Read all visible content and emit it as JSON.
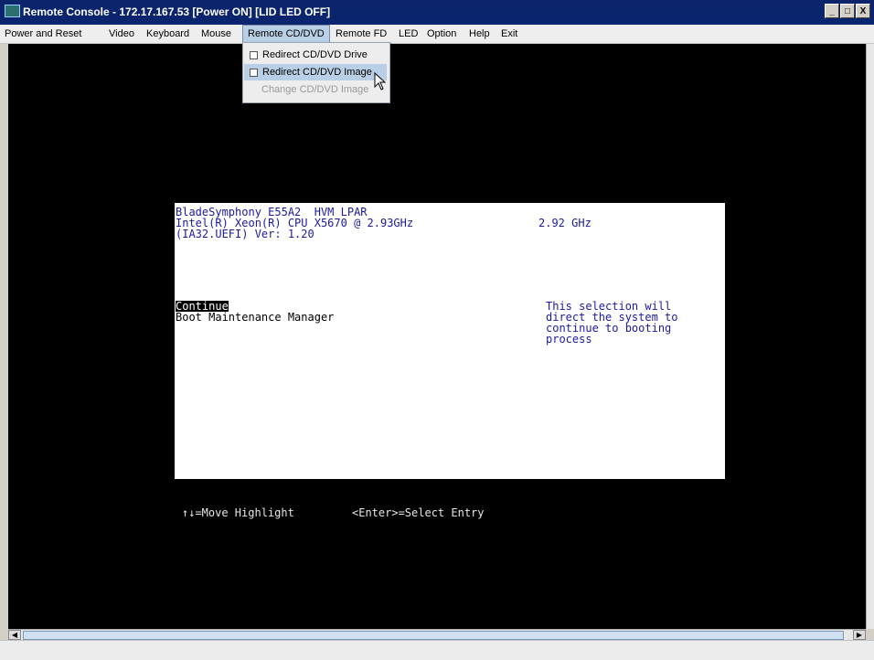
{
  "window": {
    "title": "Remote Console - 172.17.167.53 [Power ON] [LID LED OFF]",
    "minimize_glyph": "_",
    "maximize_glyph": "□",
    "close_glyph": "X"
  },
  "menubar": {
    "items": [
      {
        "label": "Power and Reset"
      },
      {
        "label": "Video"
      },
      {
        "label": "Keyboard"
      },
      {
        "label": "Mouse"
      },
      {
        "label": "Remote CD/DVD",
        "active": true
      },
      {
        "label": "Remote FD"
      },
      {
        "label": "LED"
      },
      {
        "label": "Option"
      },
      {
        "label": "Help"
      },
      {
        "label": "Exit"
      }
    ]
  },
  "dropdown": {
    "items": [
      {
        "label": "Redirect CD/DVD Drive",
        "checkbox": true,
        "checked": false
      },
      {
        "label": "Redirect CD/DVD Image",
        "checkbox": true,
        "checked": false,
        "highlighted": true
      },
      {
        "label": "Change CD/DVD Image",
        "disabled": true
      }
    ]
  },
  "bios": {
    "model": "BladeSymphony E55A2  HVM LPAR",
    "cpu": "Intel(R) Xeon(R) CPU X5670 @ 2.93GHz",
    "freq": "2.92 GHz",
    "firmware": "(IA32.UEFI) Ver: 1.20",
    "menu_items": [
      "Continue",
      "Boot Maintenance Manager"
    ],
    "help_lines": [
      "This selection will",
      "direct the system to",
      "continue to booting",
      "process"
    ],
    "hint_move": "↑↓=Move Highlight",
    "hint_select": "<Enter>=Select Entry"
  },
  "scrollbar": {
    "left_arrow": "◀",
    "right_arrow": "▶"
  },
  "colors": {
    "titlebar": "#0a246a",
    "console_bg": "#000000",
    "bios_text_blue": "#1a1aa0",
    "menu_highlight": "#b8cfe5"
  }
}
